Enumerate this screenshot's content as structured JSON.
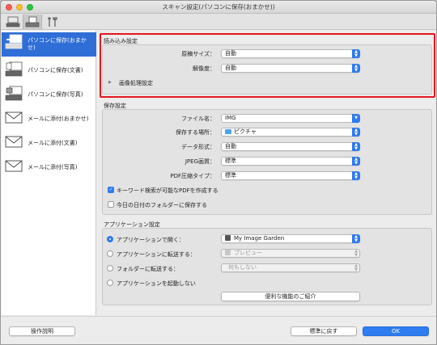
{
  "window": {
    "title": "スキャン設定(パソコンに保存(おまかせ))"
  },
  "sidebar": {
    "items": [
      {
        "label": "パソコンに保存(おまかせ)"
      },
      {
        "label": "パソコンに保存(文書)"
      },
      {
        "label": "パソコンに保存(写真)"
      },
      {
        "label": "メールに添付(おまかせ)"
      },
      {
        "label": "メールに添付(文書)"
      },
      {
        "label": "メールに添付(写真)"
      }
    ]
  },
  "scan_settings": {
    "title": "読み込み設定",
    "doc_size_label": "原稿サイズ：",
    "doc_size_value": "自動",
    "resolution_label": "解像度：",
    "resolution_value": "自動",
    "image_processing_label": "画像処理設定"
  },
  "save_settings": {
    "title": "保存設定",
    "file_name_label": "ファイル名：",
    "file_name_value": "IMG",
    "save_location_label": "保存する場所：",
    "save_location_value": "ピクチャ",
    "data_format_label": "データ形式：",
    "data_format_value": "自動",
    "jpeg_quality_label": "JPEG画質：",
    "jpeg_quality_value": "標準",
    "pdf_compression_label": "PDF圧縮タイプ：",
    "pdf_compression_value": "標準",
    "keyword_pdf_label": "キーワード検索が可能なPDFを作成する",
    "date_folder_label": "今日の日付のフォルダーに保存する"
  },
  "app_settings": {
    "title": "アプリケーション設定",
    "open_with_label": "アプリケーションで開く：",
    "open_with_value": "My Image Garden",
    "send_to_app_label": "アプリケーションに転送する：",
    "send_to_app_value": "プレビュー",
    "send_to_folder_label": "フォルダーに転送する：",
    "send_to_folder_value": "何もしない",
    "no_launch_label": "アプリケーションを起動しない",
    "useful_features_label": "便利な機能のご紹介"
  },
  "footer": {
    "instructions_label": "操作説明",
    "defaults_label": "標準に戻す",
    "ok_label": "OK"
  },
  "colors": {
    "accent": "#2f7bf0",
    "highlight": "#e3161d",
    "selected": "#2f6ed6"
  }
}
